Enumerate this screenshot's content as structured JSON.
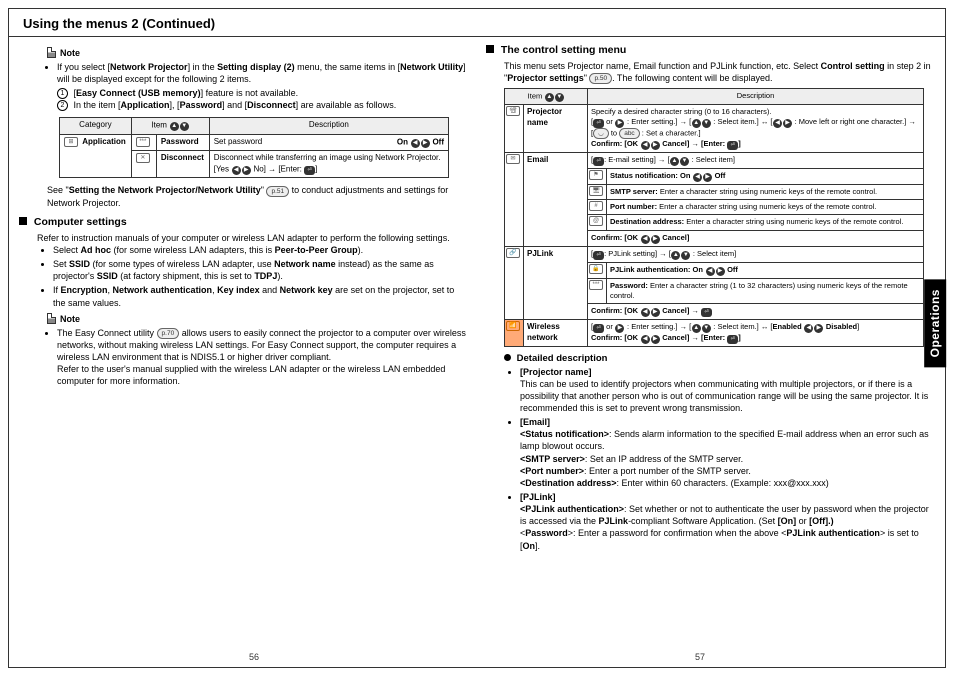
{
  "title": "Using the menus 2 (Continued)",
  "sideTab": "Operations",
  "pageL": "56",
  "pageR": "57",
  "left": {
    "noteLabel": "Note",
    "noteIntro": "If you select [",
    "b_np": "Network Projector",
    "noteIntro2": "] in the ",
    "b_sd2": "Setting display (2)",
    "noteIntro3": " menu, the same items in [",
    "b_nu": "Network Utility",
    "noteIntro4": "] will be displayed except for the following 2 items.",
    "n1": "[",
    "b_ec": "Easy Connect (USB memory)",
    "n1b": "] feature is not available.",
    "n2": "In the item [",
    "b_app": "Application",
    "n2b": "], [",
    "b_pw": "Password",
    "n2c": "] and [",
    "b_dc": "Disconnect",
    "n2d": "] are available as follows.",
    "tbl": {
      "h1": "Category",
      "h2": "Item",
      "h3": "Description",
      "r1c1": "Application",
      "r1c2": "Password",
      "r1c3a": "Set password",
      "r1c3b": "On",
      "r1c3c": "Off",
      "r2c2": "Disconnect",
      "r2c3": "Disconnect while transferring an image using Network Projector.",
      "r2c3b": "[Yes ",
      "r2c3c": " No] → [Enter: ",
      "r2c3d": "]"
    },
    "see1": "See \"",
    "see_b": "Setting the Network Projector/Network Utility",
    "see2": "\" ",
    "see_pill": "p.51",
    "see3": " to conduct adjustments and settings for Network Projector.",
    "comp_title": " Computer settings",
    "comp_p": "Refer to instruction manuals of your computer or wireless LAN adapter to perform the following settings.",
    "li1a": "Select ",
    "li1b": "Ad hoc",
    "li1c": " (for some wireless  LAN adapters, this is ",
    "li1d": "Peer-to-Peer Group",
    "li1e": ").",
    "li2a": "Set ",
    "li2b": "SSID",
    "li2c": " (for some types of wireless LAN adapter, use ",
    "li2d": "Network name",
    "li2e": " instead) as the same as projector's ",
    "li2f": "SSID",
    "li2g": " (at factory shipment, this is set to ",
    "li2h": "TDPJ",
    "li2i": ").",
    "li3a": "If ",
    "li3b": "Encryption",
    "li3c": ", ",
    "li3d": "Network authentication",
    "li3e": ", ",
    "li3f": "Key index",
    "li3g": " and ",
    "li3h": "Network key",
    "li3i": " are set on the projector, set to the same values.",
    "note2Label": "Note",
    "note2a": "The Easy Connect utility ",
    "note2pill": "p.70",
    "note2b": " allows users to easily connect the projector to a computer over wireless networks, without making wireless LAN settings. For Easy Connect support, the computer requires a wireless LAN environment that is NDIS5.1 or higher driver compliant.",
    "note2c": "Refer to the user's manual supplied with the wireless LAN adapter or the wireless LAN embedded computer for more information."
  },
  "right": {
    "title": " The control setting menu",
    "intro1": "This menu sets Projector name, Email function and PJLink function, etc. Select ",
    "intro_b": "Control setting",
    "intro2": " in step 2 in \"",
    "intro_b2": "Projector settings",
    "intro3": "\" ",
    "intro_pill": "p.50",
    "intro4": ". The following content will be displayed.",
    "th1": "Item",
    "th2": "Description",
    "rows": {
      "projName": "Projector name",
      "projDesc1": "Specify a desired character string (0 to 16 characters).",
      "projDesc2a": "[",
      "projDesc2b": " or ",
      "projDesc2c": " : Enter setting.] → [",
      "projDesc2d": " : Select item.] ↔ [",
      "projDesc2e": " : Move left or right one character.] → [",
      "projDesc2f": " to ",
      "projDesc2g": " : Set a character.]",
      "confirm": "Confirm: [OK ",
      "confirm2": " Cancel] → [Enter: ",
      "confirm3": "]",
      "email": "Email",
      "emailA": "[",
      "emailA2": ": E-mail setting] → [",
      "emailA3": " : Select item]",
      "statusNotif": "Status notification: On ",
      "statusNotif2": " Off",
      "smtp": "SMTP server:",
      "smtp2": " Enter a character string using numeric keys of the remote control.",
      "port": "Port number:",
      "port2": " Enter a character string using numeric keys of the remote control.",
      "dest": "Destination address:",
      "dest2": " Enter a character string using numeric keys of the remote control.",
      "confirmE": "Confirm:    [OK ",
      "confirmE2": " Cancel]",
      "pj": "PJLink",
      "pjA": "[",
      "pjA2": ": PJLink setting] → [",
      "pjA3": " : Select item]",
      "pjAuth": "PJLink authentication: On ",
      "pjAuth2": " Off",
      "pjPass": "Password:",
      "pjPass2": " Enter a character string (1 to 32 characters) using numeric keys of the remote control.",
      "pjConf": "Confirm: [OK ",
      "pjConf2": " Cancel] → ",
      "pjConf3": "",
      "wl": "Wireless network",
      "wlA": "[",
      "wlA2": " or ",
      "wlA3": " : Enter setting.] → [",
      "wlA4": " : Select item.] ↔ [",
      "wlA5": "Enabled ",
      "wlA6": " Disabled",
      "wlA7": "]",
      "wlB": "Confirm: [OK ",
      "wlB2": " Cancel] → [Enter: ",
      "wlB3": "]"
    },
    "dd_title": " Detailed description",
    "dd1t": "[Projector name]",
    "dd1": "This can be used to identify projectors when communicating with multiple projectors, or if there is a possibility that another person who is out of communication range will be using the same projector. It is recommended this is set to prevent wrong transmission.",
    "dd2t": "[Email]",
    "dd2a": "<Status notification>",
    "dd2a2": ": Sends alarm information to the specified E-mail address when an error such as lamp blowout occurs.",
    "dd2b": "<SMTP server>",
    "dd2b2": ": Set an IP address of the SMTP server.",
    "dd2c": "<Port number>",
    "dd2c2": ": Enter a port number of the SMTP server.",
    "dd2d": "<Destination address>",
    "dd2d2": ": Enter within 60 characters. (Example: xxx@xxx.xxx)",
    "dd3t": "[PJLink]",
    "dd3a": "<PJLink authentication>",
    "dd3a2": ": Set whether or not to authenticate the user by password when the projector is accessed via the ",
    "dd3a3": "PJLink",
    "dd3a4": "-compliant Software Application. (Set ",
    "dd3a5": "[On]",
    "dd3a6": " or ",
    "dd3a7": "[Off].)",
    "dd3b": "<",
    "dd3b1": "Password",
    "dd3b2": ">: Enter a password for confirmation when the above <",
    "dd3b3": "PJLink authentication",
    "dd3b4": "> is set to [",
    "dd3b5": "On",
    "dd3b6": "]."
  }
}
